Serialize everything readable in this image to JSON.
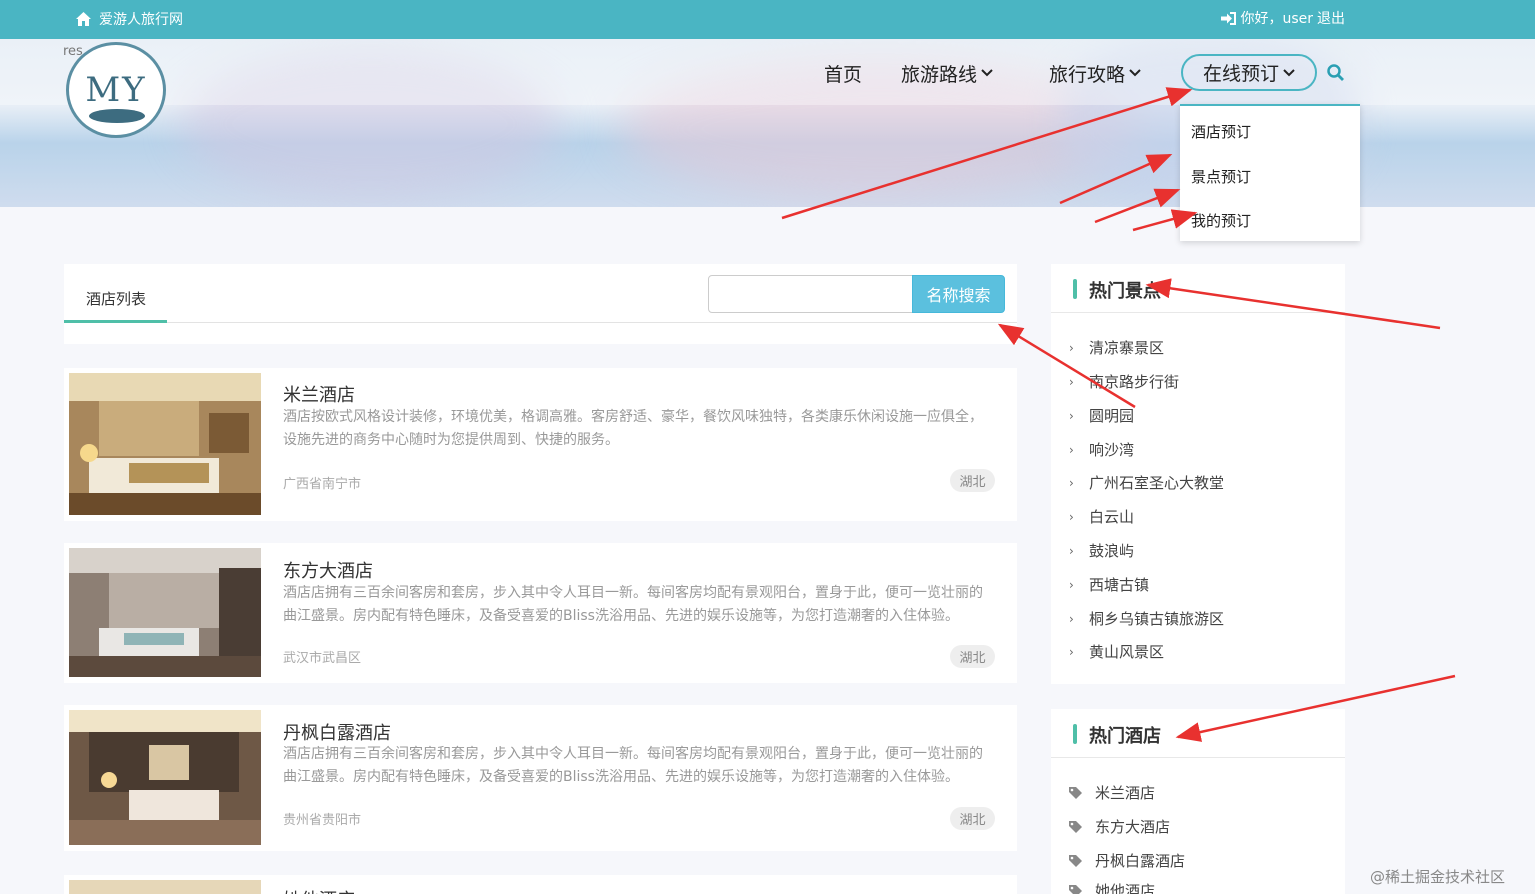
{
  "topbar": {
    "site_name": "爱游人旅行网",
    "greeting": "你好，user",
    "logout": "退出"
  },
  "brand": {
    "res_text": "res",
    "logo_text": "MY"
  },
  "nav": {
    "home": "首页",
    "routes": "旅游路线",
    "guides": "旅行攻略",
    "booking": "在线预订"
  },
  "dropdown": [
    "酒店预订",
    "景点预订",
    "我的预订"
  ],
  "list": {
    "tab": "酒店列表",
    "search_button": "名称搜索",
    "search_value": ""
  },
  "hotels": [
    {
      "name": "米兰酒店",
      "desc": "酒店按欧式风格设计装修，环境优美，格调高雅。客房舒适、豪华，餐饮风味独特，各类康乐休闲设施一应俱全，设施先进的商务中心随时为您提供周到、快捷的服务。",
      "location": "广西省南宁市",
      "tag": "湖北"
    },
    {
      "name": "东方大酒店",
      "desc": "酒店店拥有三百余间客房和套房，步入其中令人耳目一新。每间客房均配有景观阳台，置身于此，便可一览壮丽的曲江盛景。房内配有特色睡床，及备受喜爱的Bliss洗浴用品、先进的娱乐设施等，为您打造潮奢的入住体验。",
      "location": "武汉市武昌区",
      "tag": "湖北"
    },
    {
      "name": "丹枫白露酒店",
      "desc": "酒店店拥有三百余间客房和套房，步入其中令人耳目一新。每间客房均配有景观阳台，置身于此，便可一览壮丽的曲江盛景。房内配有特色睡床，及备受喜爱的Bliss洗浴用品、先进的娱乐设施等，为您打造潮奢的入住体验。",
      "location": "贵州省贵阳市",
      "tag": "湖北"
    },
    {
      "name": "她他酒店",
      "desc": "",
      "location": "",
      "tag": ""
    }
  ],
  "hot_spots": {
    "title": "热门景点",
    "items": [
      "清凉寨景区",
      "南京路步行街",
      "圆明园",
      "响沙湾",
      "广州石室圣心大教堂",
      "白云山",
      "鼓浪屿",
      "西塘古镇",
      "桐乡乌镇古镇旅游区",
      "黄山风景区"
    ]
  },
  "hot_hotels": {
    "title": "热门酒店",
    "items": [
      "米兰酒店",
      "东方大酒店",
      "丹枫白露酒店",
      "她他酒店"
    ]
  },
  "watermark": "@稀土掘金技术社区",
  "colors": {
    "accent": "#4ab5c3",
    "tab_underline": "#4fbfa8",
    "search_button": "#5bc0de",
    "annotation_arrow": "#e8312f"
  }
}
